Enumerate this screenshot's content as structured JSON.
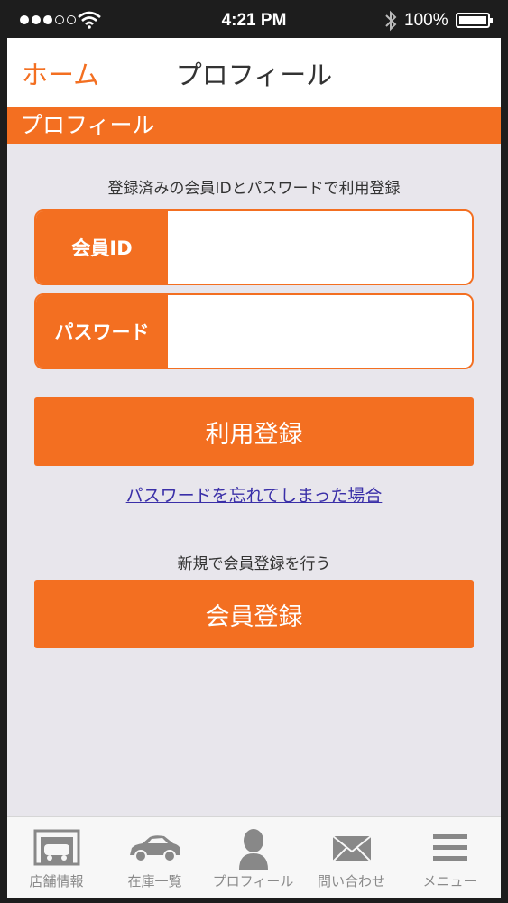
{
  "status_bar": {
    "time": "4:21 PM",
    "battery": "100%"
  },
  "nav": {
    "back_label": "ホーム",
    "title": "プロフィール"
  },
  "section_header": "プロフィール",
  "login": {
    "caption": "登録済みの会員IDとパスワードで利用登録",
    "member_id_label": "会員ID",
    "member_id_value": "",
    "password_label": "パスワード",
    "password_value": "",
    "submit_label": "利用登録",
    "forgot_link": "パスワードを忘れてしまった場合"
  },
  "register": {
    "caption": "新規で会員登録を行う",
    "button_label": "会員登録"
  },
  "tabs": [
    {
      "label": "店舗情報",
      "icon": "garage-icon"
    },
    {
      "label": "在庫一覧",
      "icon": "car-icon"
    },
    {
      "label": "プロフィール",
      "icon": "person-icon"
    },
    {
      "label": "問い合わせ",
      "icon": "mail-icon"
    },
    {
      "label": "メニュー",
      "icon": "menu-icon"
    }
  ],
  "colors": {
    "accent": "#f36f21",
    "background": "#e8e6ec",
    "link": "#3a2fa8"
  }
}
